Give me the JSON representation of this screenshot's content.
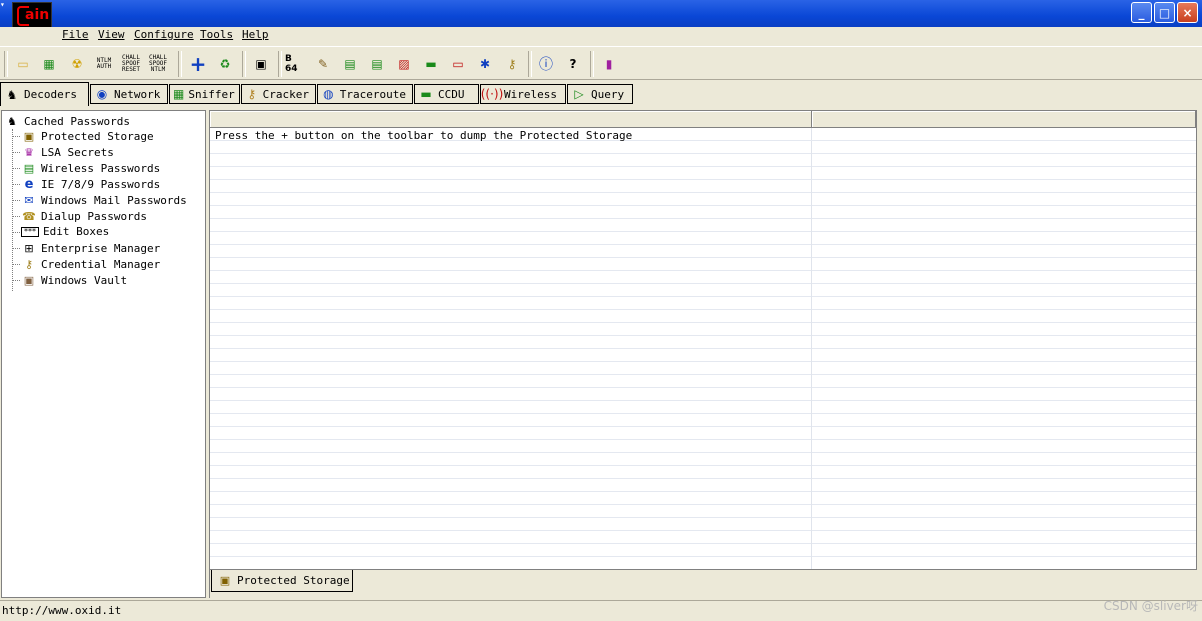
{
  "window": {
    "app_icon_text": "ain",
    "buttons": {
      "minimize": "_",
      "maximize": "□",
      "close": "×"
    }
  },
  "menu": {
    "items": [
      {
        "label": "File"
      },
      {
        "label": "View"
      },
      {
        "label": "Configure"
      },
      {
        "label": "Tools"
      },
      {
        "label": "Help"
      }
    ]
  },
  "toolbar": {
    "ntlm_auth_label": "NTLM AUTH",
    "chall_spoof_reset_label": "CHALL SPOOF RESET",
    "chall_spoof_ntlm_label": "CHALL SPOOF NTLM",
    "base64_label": "B 64",
    "icons": [
      "open-folder-icon",
      "network-card-icon",
      "radiation-icon",
      "ntlm-auth-icon",
      "chall-spoof-reset-icon",
      "chall-spoof-ntlm-icon",
      "add-plus-icon",
      "recycle-icon",
      "certificate-icon",
      "base64-icon",
      "hash-icon",
      "wep-icon",
      "wpa-icon",
      "rsa-icon",
      "modem-icon",
      "router-icon",
      "wireless-key-icon",
      "key-icon",
      "info-icon",
      "help-icon",
      "exit-icon"
    ]
  },
  "tabs": [
    {
      "label": "Decoders",
      "icon": "decoders-icon",
      "active": true
    },
    {
      "label": "Network",
      "icon": "network-icon"
    },
    {
      "label": "Sniffer",
      "icon": "sniffer-icon"
    },
    {
      "label": "Cracker",
      "icon": "cracker-icon"
    },
    {
      "label": "Traceroute",
      "icon": "traceroute-icon"
    },
    {
      "label": "CCDU",
      "icon": "ccdu-icon"
    },
    {
      "label": "Wireless",
      "icon": "wireless-icon"
    },
    {
      "label": "Query",
      "icon": "query-icon"
    }
  ],
  "tree": {
    "root": "Cached Passwords",
    "items": [
      {
        "label": "Protected Storage",
        "icon": "protected-storage-icon"
      },
      {
        "label": "LSA Secrets",
        "icon": "lsa-secrets-icon"
      },
      {
        "label": "Wireless Passwords",
        "icon": "wireless-passwords-icon"
      },
      {
        "label": "IE 7/8/9 Passwords",
        "icon": "ie-icon"
      },
      {
        "label": "Windows Mail Passwords",
        "icon": "windows-mail-icon"
      },
      {
        "label": "Dialup Passwords",
        "icon": "dialup-icon"
      },
      {
        "label": "Edit Boxes",
        "icon": "edit-boxes-icon"
      },
      {
        "label": "Enterprise Manager",
        "icon": "enterprise-manager-icon"
      },
      {
        "label": "Credential Manager",
        "icon": "credential-manager-icon"
      },
      {
        "label": "Windows Vault",
        "icon": "windows-vault-icon"
      }
    ]
  },
  "grid": {
    "rows": [
      "Press the + button on the toolbar to dump the Protected Storage"
    ]
  },
  "bottom_tab": {
    "label": "Protected Storage",
    "icon": "protected-storage-icon"
  },
  "status": {
    "text": "http://www.oxid.it"
  },
  "watermark": "CSDN @sliver呀"
}
